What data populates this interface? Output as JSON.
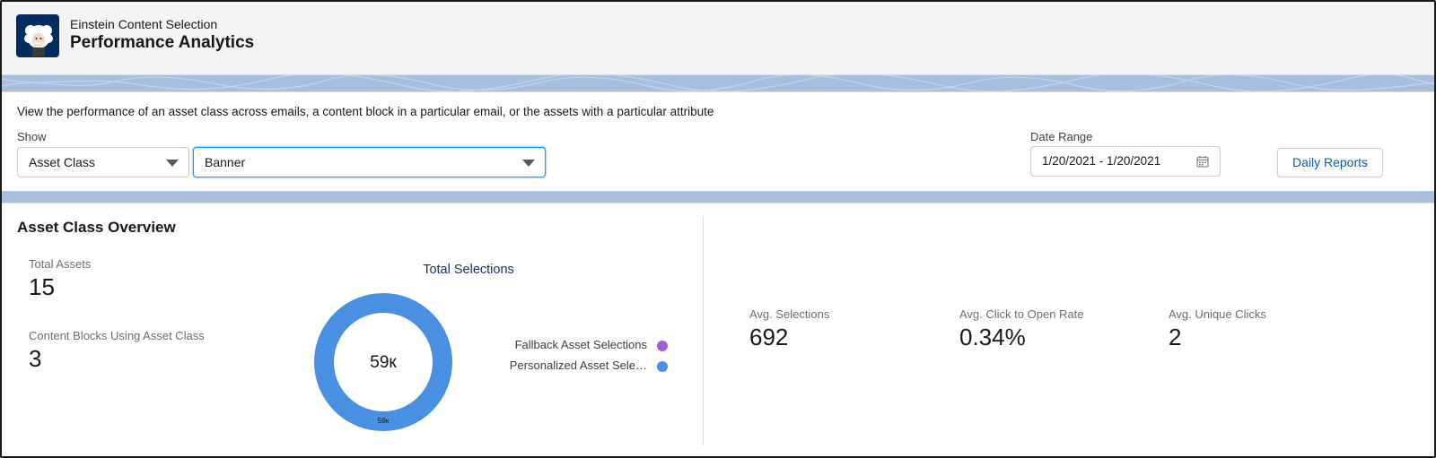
{
  "header": {
    "subtitle": "Einstein Content Selection",
    "title": "Performance Analytics"
  },
  "filters": {
    "description": "View the performance of an asset class across emails, a content block in a particular email, or the assets with a particular attribute",
    "show_label": "Show",
    "show_type_value": "Asset Class",
    "show_value": "Banner",
    "date_range_label": "Date Range",
    "date_range_value": "1/20/2021 - 1/20/2021",
    "daily_reports_label": "Daily Reports"
  },
  "overview": {
    "title": "Asset Class Overview",
    "total_assets_label": "Total Assets",
    "total_assets_value": "15",
    "content_blocks_label": "Content Blocks Using Asset Class",
    "content_blocks_value": "3",
    "avg_selections_label": "Avg. Selections",
    "avg_selections_value": "692",
    "avg_ctor_label": "Avg. Click to Open Rate",
    "avg_ctor_value": "0.34%",
    "avg_unique_clicks_label": "Avg. Unique Clicks",
    "avg_unique_clicks_value": "2"
  },
  "chart_data": {
    "type": "pie",
    "title": "Total Selections",
    "center_label": "59к",
    "slice_label": "59к",
    "series": [
      {
        "name": "Fallback Asset Selections",
        "value": 0,
        "color": "#9a5fe0"
      },
      {
        "name": "Personalized Asset Sele…",
        "value": 59000,
        "color": "#4a90e2"
      }
    ]
  },
  "colors": {
    "brand_blue": "#0b5cab",
    "donut_blue": "#4a90e2",
    "fallback_purple": "#9a5fe0"
  }
}
